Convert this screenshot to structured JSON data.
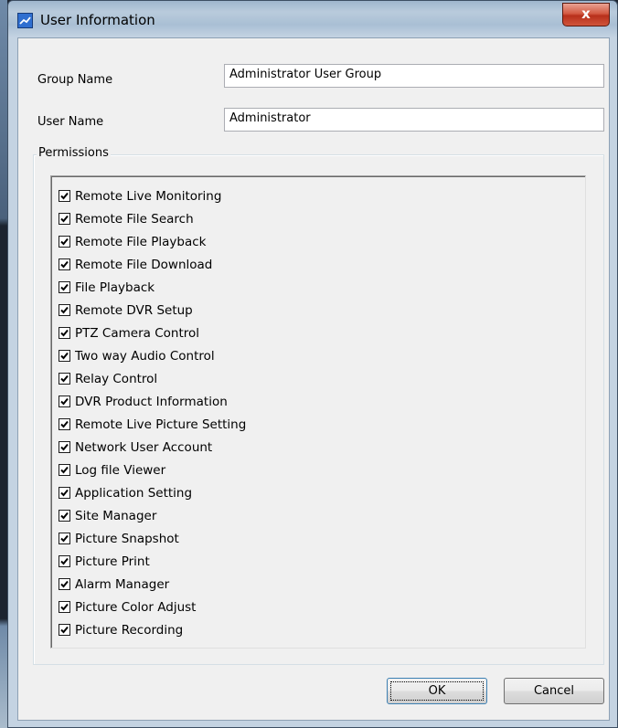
{
  "window": {
    "title": "User Information",
    "close_glyph": "x"
  },
  "form": {
    "group_name_label": "Group Name",
    "group_name_value": "Administrator User Group",
    "user_name_label": "User Name",
    "user_name_value": "Administrator"
  },
  "permissions": {
    "legend": "Permissions",
    "items": [
      {
        "label": "Remote Live Monitoring",
        "checked": true
      },
      {
        "label": "Remote File Search",
        "checked": true
      },
      {
        "label": "Remote File Playback",
        "checked": true
      },
      {
        "label": "Remote File Download",
        "checked": true
      },
      {
        "label": "File Playback",
        "checked": true
      },
      {
        "label": "Remote DVR Setup",
        "checked": true
      },
      {
        "label": "PTZ Camera Control",
        "checked": true
      },
      {
        "label": "Two way Audio Control",
        "checked": true
      },
      {
        "label": "Relay Control",
        "checked": true
      },
      {
        "label": "DVR Product Information",
        "checked": true
      },
      {
        "label": "Remote Live Picture Setting",
        "checked": true
      },
      {
        "label": "Network User Account",
        "checked": true
      },
      {
        "label": "Log file Viewer",
        "checked": true
      },
      {
        "label": "Application Setting",
        "checked": true
      },
      {
        "label": "Site Manager",
        "checked": true
      },
      {
        "label": "Picture Snapshot",
        "checked": true
      },
      {
        "label": "Picture Print",
        "checked": true
      },
      {
        "label": "Alarm Manager",
        "checked": true
      },
      {
        "label": "Picture Color Adjust",
        "checked": true
      },
      {
        "label": "Picture Recording",
        "checked": true
      }
    ]
  },
  "buttons": {
    "ok_label": "OK",
    "cancel_label": "Cancel"
  }
}
